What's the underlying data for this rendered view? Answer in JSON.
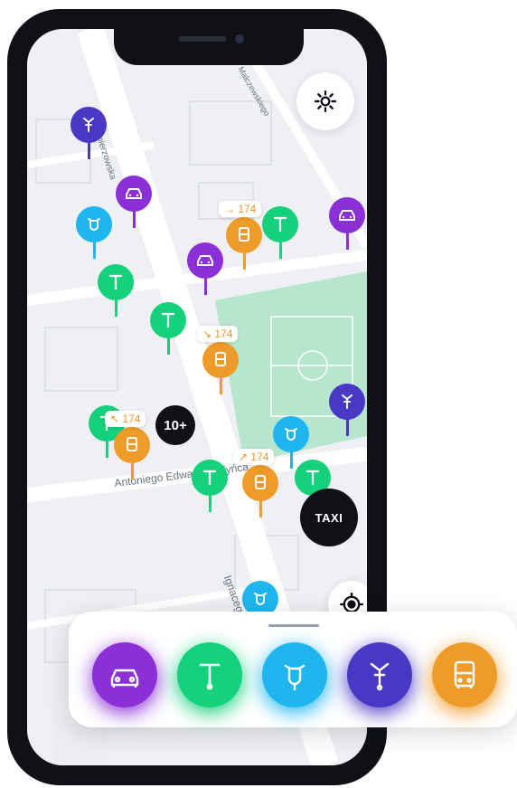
{
  "colors": {
    "car": "#8b2fd6",
    "scooter": "#15d17c",
    "moped": "#1fb6f0",
    "bike": "#4a37c3",
    "bus": "#ef9b2a",
    "dark": "#0f1117",
    "park": "#b7e6cf"
  },
  "map": {
    "streets": [
      {
        "name": "Antoniego Edwarda Odyńca"
      },
      {
        "name": "Ignacego Krasickiego"
      },
      {
        "name": "Kazimierzowska"
      },
      {
        "name": "Malczewskiego"
      }
    ],
    "cluster_label": "10+",
    "route_badges": [
      {
        "label": "→ 174"
      },
      {
        "label": "↘ 174"
      },
      {
        "label": "↖ 174"
      },
      {
        "label": "↗ 174"
      }
    ]
  },
  "controls": {
    "settings_icon": "gear-icon",
    "locate_icon": "crosshair-icon",
    "taxi_label": "TAXI"
  },
  "tray": {
    "items": [
      {
        "name": "car",
        "icon": "car-icon"
      },
      {
        "name": "scooter",
        "icon": "kick-scooter-icon"
      },
      {
        "name": "moped",
        "icon": "moped-icon"
      },
      {
        "name": "bike",
        "icon": "bicycle-icon"
      },
      {
        "name": "bus",
        "icon": "bus-icon"
      }
    ]
  }
}
